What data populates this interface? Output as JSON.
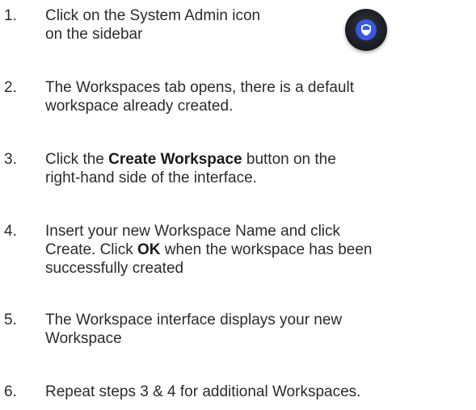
{
  "steps": [
    {
      "number": "1.",
      "lines": [
        "Click on the System Admin icon",
        "on the sidebar"
      ]
    },
    {
      "number": "2.",
      "lines": [
        "The Workspaces tab opens, there is a default",
        "workspace already created."
      ]
    },
    {
      "number": "3.",
      "line1_before": "Click the ",
      "line1_bold": "Create Workspace",
      "line1_after": " button on the",
      "line2": "right-hand side of the interface."
    },
    {
      "number": "4.",
      "line1": "Insert your new Workspace Name and click",
      "line2_before": "Create. Click ",
      "line2_bold": "OK",
      "line2_after": " when the workspace has been",
      "line3": "successfully created"
    },
    {
      "number": "5.",
      "lines": [
        "The Workspace interface displays your new",
        "Workspace"
      ]
    },
    {
      "number": "6.",
      "lines": [
        "Repeat steps 3 & 4 for additional Workspaces."
      ]
    }
  ],
  "icons": {
    "system_admin": "shield-icon",
    "accent_color": "#3b57e4"
  }
}
